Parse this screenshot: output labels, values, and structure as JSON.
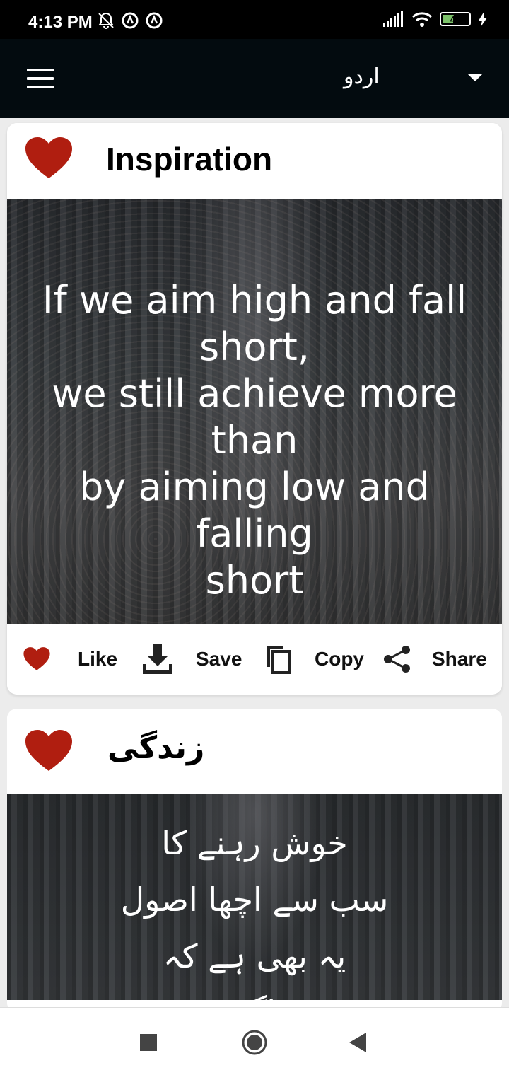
{
  "status_bar": {
    "time": "4:13 PM",
    "battery_level": "40",
    "battery_fraction": 0.4,
    "icons": [
      "muted-bell-icon",
      "a-circle-icon",
      "a-circle-icon",
      "signal-icon",
      "wifi-icon",
      "battery-icon",
      "charging-icon"
    ]
  },
  "app_bar": {
    "menu_icon": "hamburger-menu-icon",
    "language": "اردو"
  },
  "cards": [
    {
      "category": "Inspiration",
      "quote": "If we aim high and fall\nshort,\nwe still achieve more\nthan\nby aiming low and falling\nshort",
      "actions": {
        "like": "Like",
        "save": "Save",
        "copy": "Copy",
        "share": "Share"
      }
    },
    {
      "category": "زندگی",
      "quote": "خوش رہنے کا\nسب سے اچھا اصول\nیہ بھی ہے کہ\nاگر"
    }
  ],
  "colors": {
    "heart": "#b01e10",
    "app_bar": "#030b0f",
    "status_bar": "#000000"
  }
}
